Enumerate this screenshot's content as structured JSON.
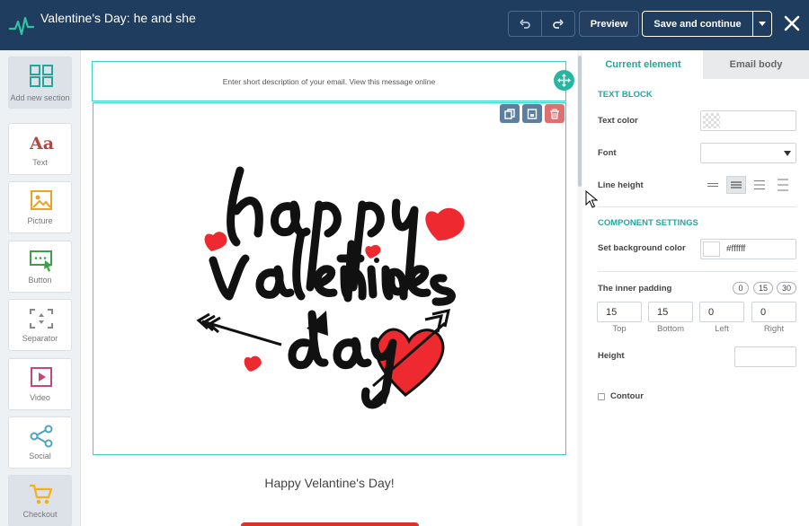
{
  "header": {
    "title": "Valentine's Day: he and she",
    "preview_label": "Preview",
    "save_label": "Save and continue"
  },
  "tools": [
    {
      "label": "Add new section",
      "icon": "add-section-icon"
    },
    {
      "label": "Text",
      "icon": "text-icon"
    },
    {
      "label": "Picture",
      "icon": "picture-icon"
    },
    {
      "label": "Button",
      "icon": "button-icon"
    },
    {
      "label": "Separator",
      "icon": "separator-icon"
    },
    {
      "label": "Video",
      "icon": "video-icon"
    },
    {
      "label": "Social",
      "icon": "social-icon"
    },
    {
      "label": "Checkout",
      "icon": "cart-icon"
    }
  ],
  "canvas": {
    "preheader": "Enter short description of your email. View this message online",
    "greeting": "Happy Velantine's Day!"
  },
  "panel": {
    "tabs": {
      "current": "Current element",
      "body": "Email body"
    },
    "text_block_title": "TEXT BLOCK",
    "text_color_label": "Text color",
    "font_label": "Font",
    "line_height_label": "Line height",
    "component_settings_title": "COMPONENT SETTINGS",
    "bg_color_label": "Set background color",
    "bg_color_value": "#ffffff",
    "inner_padding_label": "The inner padding",
    "padding_presets": [
      "0",
      "15",
      "30"
    ],
    "padding": [
      {
        "label": "Top",
        "value": "15"
      },
      {
        "label": "Bottom",
        "value": "15"
      },
      {
        "label": "Left",
        "value": "0"
      },
      {
        "label": "Right",
        "value": "0"
      }
    ],
    "height_label": "Height",
    "contour_label": "Contour"
  },
  "colors": {
    "header_bg": "#1f3d5f",
    "accent": "#26a69a",
    "selection": "#3dd0c3",
    "delete": "#e07070",
    "cta_red": "#d9322c"
  }
}
